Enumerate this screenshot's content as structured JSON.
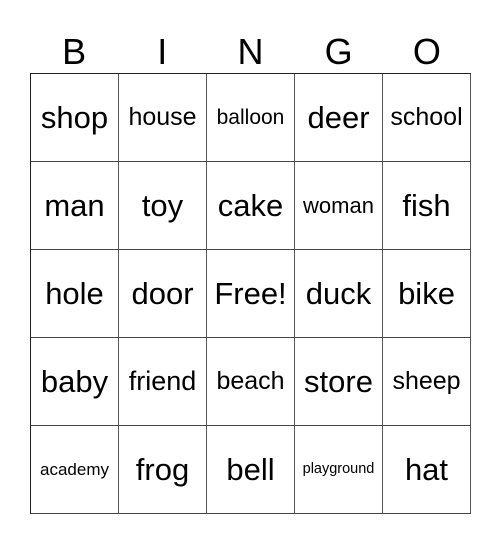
{
  "header": {
    "letters": [
      "B",
      "I",
      "N",
      "G",
      "O"
    ]
  },
  "card": {
    "rows": [
      [
        "shop",
        "house",
        "balloon",
        "deer",
        "school"
      ],
      [
        "man",
        "toy",
        "cake",
        "woman",
        "fish"
      ],
      [
        "hole",
        "door",
        "Free!",
        "duck",
        "bike"
      ],
      [
        "baby",
        "friend",
        "beach",
        "store",
        "sheep"
      ],
      [
        "academy",
        "frog",
        "bell",
        "playground",
        "hat"
      ]
    ]
  }
}
